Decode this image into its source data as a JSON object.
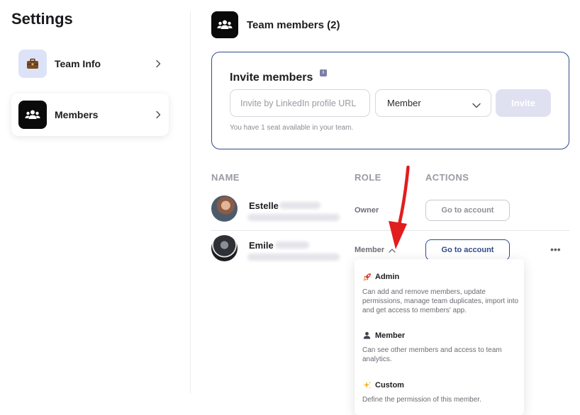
{
  "sidebar": {
    "title": "Settings",
    "items": [
      {
        "label": "Team Info",
        "icon": "briefcase-icon"
      },
      {
        "label": "Members",
        "icon": "team-icon"
      }
    ]
  },
  "header": {
    "title": "Team members (2)",
    "icon": "team-icon"
  },
  "invite": {
    "title": "Invite members",
    "input_placeholder": "Invite by LinkedIn profile URL",
    "role_selected": "Member",
    "button_label": "Invite",
    "seat_note": "You have 1 seat available in your team."
  },
  "table": {
    "columns": [
      "NAME",
      "ROLE",
      "ACTIONS"
    ],
    "rows": [
      {
        "name": "Estelle",
        "role": "Owner",
        "action": "Go to account"
      },
      {
        "name": "Emile",
        "role": "Member",
        "action": "Go to account"
      }
    ]
  },
  "role_menu": {
    "options": [
      {
        "label": "Admin",
        "icon": "rocket-icon",
        "description": "Can add and remove members, update permissions, manage team duplicates, import into and get access to members' app."
      },
      {
        "label": "Member",
        "icon": "person-icon",
        "description": "Can see other members and access to team analytics."
      },
      {
        "label": "Custom",
        "icon": "sparkles-icon",
        "description": "Define the permission of this member."
      }
    ]
  },
  "colors": {
    "accent": "#2f4a8a",
    "invite_button_disabled": "#dfe1f1",
    "arrow": "#e11d1d"
  }
}
